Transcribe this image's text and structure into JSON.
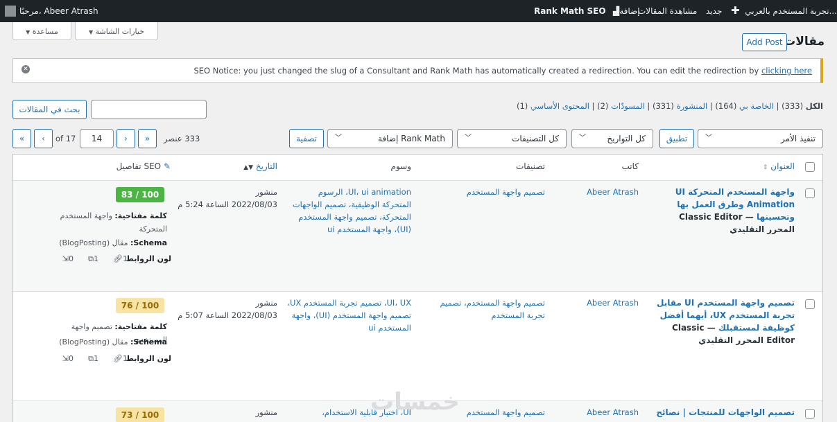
{
  "admin_bar": {
    "site": "تجربة المستخدم بالعربي...",
    "new": "جديد",
    "view_posts": "مشاهدة المقالات",
    "rankmath": "Rank Math SEO",
    "greeting": "مرحبًا، Abeer Atrash"
  },
  "header": {
    "page_title": "مقالات",
    "add_post": "Add Post",
    "screen_options": "خيارات الشاشة",
    "help": "مساعدة"
  },
  "notice": {
    "text": "SEO Notice: you just changed the slug of a Consultant and Rank Math has automatically created a redirection. You can edit the redirection by",
    "link": "clicking here"
  },
  "filters": {
    "views": [
      {
        "label": "الكل",
        "count": "(333)"
      },
      {
        "label": "الخاصة بي",
        "count": "(164)"
      },
      {
        "label": "المنشورة",
        "count": "(331)"
      },
      {
        "label": "المسودّات",
        "count": "(2)"
      },
      {
        "label": "المحتوى الأساسي",
        "count": "(1)"
      }
    ],
    "search_button": "بحث في المقالات",
    "bulk_action": "تنفيذ الأمر",
    "apply": "تطبيق",
    "all_dates": "كل التواريخ",
    "all_categories": "كل التصنيفات",
    "rankmath_filter": "إضافة Rank Math",
    "filter_button": "تصفية",
    "items_count": "333 عنصر",
    "current_page": "14",
    "total_pages": "of 17"
  },
  "columns": {
    "title": "العنوان",
    "author": "كاتب",
    "categories": "تصنيفات",
    "tags": "وسوم",
    "date": "التاريخ",
    "seo": "تفاصيل SEO"
  },
  "rows": [
    {
      "title": "واجهة المستخدم المتحركة UI Animation وطرق العمل بها وتحسينها",
      "suffix": "— Classic Editor المحرر التقليدي",
      "author": "Abeer Atrash",
      "categories": "تصميم واجهة المستخدم",
      "tags": "UI، ui animation، الرسوم المتحركة الوظيفية، تصميم الواجهات المتحركة، تصميم واجهة المستخدم (UI)، واجهة المستخدم ui",
      "status": "منشور",
      "date": "2022/08/03 الساعة 5:24 م",
      "score": "83 / 100",
      "score_color": "#4bb543",
      "keyword_label": "كلمة مفتاحية:",
      "keyword": "واجهة المستخدم المتحركة",
      "schema_label": "Schema:",
      "schema": "مقال (BlogPosting)",
      "links_label": "لون الروابط",
      "internal": "1",
      "external": "1",
      "incoming": "0"
    },
    {
      "title": "تصميم واجهة المستخدم UI مقابل تجربة المستخدم UX، أيهما أفضل كوظيفة لمستقبلك",
      "suffix": "— Classic Editor المحرر التقليدي",
      "author": "Abeer Atrash",
      "categories": "تصميم واجهة المستخدم، تصميم تجربة المستخدم",
      "tags": "UI، UX، تصميم تجربة المستخدم UX، تصميم واجهة المستخدم (UI)، واجهة المستخدم ui",
      "status": "منشور",
      "date": "2022/08/03 الساعة 5:07 م",
      "score": "76 / 100",
      "score_color": "#f7e3a3",
      "keyword_label": "كلمة مفتاحية:",
      "keyword": "تصميم واجهة المستخدم",
      "schema_label": "Schema:",
      "schema": "مقال (BlogPosting)",
      "links_label": "لون الروابط",
      "internal": "1",
      "external": "1",
      "incoming": "0"
    },
    {
      "title": "تصميم الواجهات للمنتجات | نصائح",
      "author": "Abeer Atrash",
      "categories": "تصميم واجهة المستخدم",
      "tags": "UI، اختبار قابلية الاستخدام،",
      "status": "منشور",
      "score": "73 / 100",
      "score_color": "#f7e3a3"
    }
  ],
  "watermark": "خمسات"
}
